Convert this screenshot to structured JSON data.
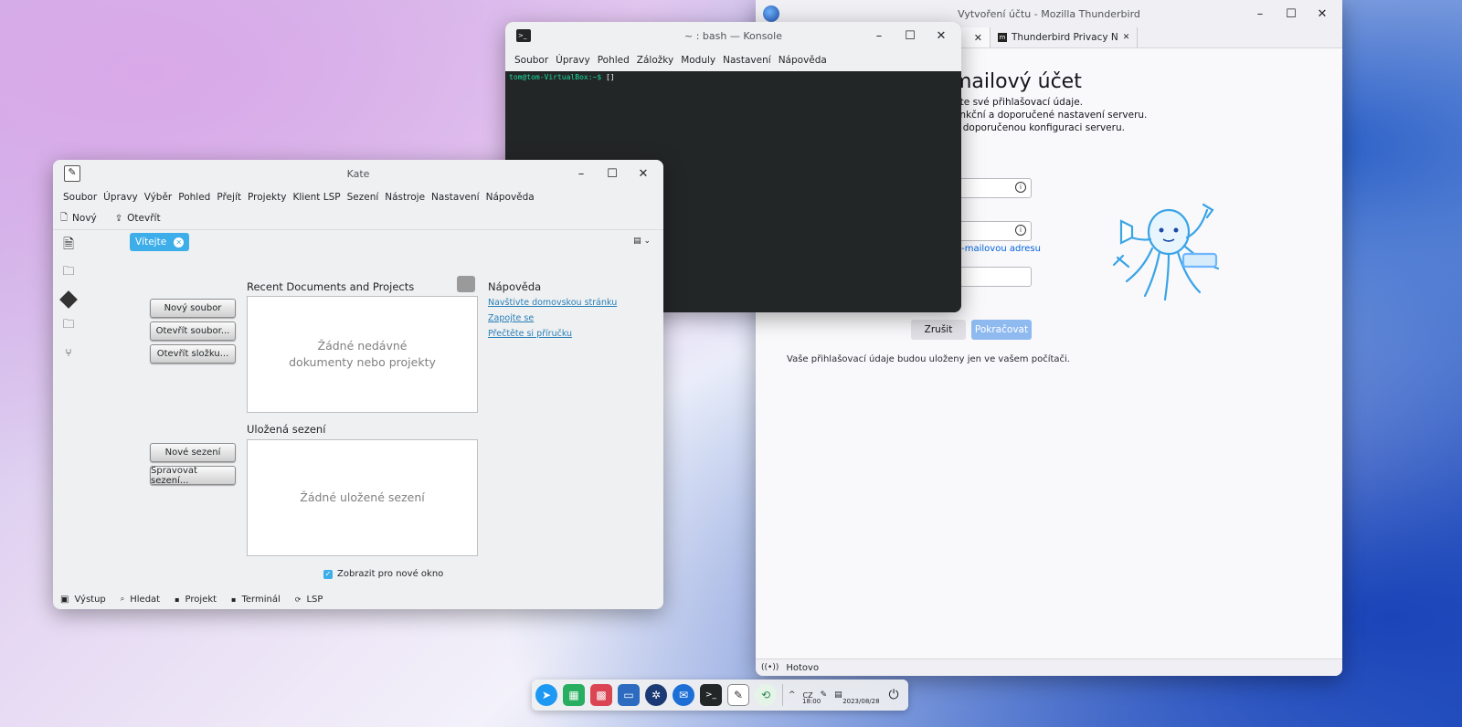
{
  "thunderbird": {
    "window_title": "Vytvoření účtu - Mozilla Thunderbird",
    "tabs": [
      {
        "label": "",
        "close": "✕"
      },
      {
        "label": "Thunderbird Privacy N",
        "close": "✕"
      }
    ],
    "heading": "mailový účet",
    "lines": [
      "ňte své přihlašovací údaje.",
      "ankční a doporučené nastavení serveru.",
      "a doporučenou konfiguraci serveru."
    ],
    "email_link": "e-mailovou adresu",
    "cancel_label": "Zrušit",
    "continue_label": "Pokračovat",
    "note": "Vaše přihlašovací údaje budou uloženy jen ve vašem počítači.",
    "status": "Hotovo"
  },
  "konsole": {
    "window_title": "~ : bash — Konsole",
    "menu": [
      "Soubor",
      "Úpravy",
      "Pohled",
      "Záložky",
      "Moduly",
      "Nastavení",
      "Nápověda"
    ],
    "prompt": "tom@tom-VirtualBox:~$",
    "cursor": "[]"
  },
  "kate": {
    "window_title": "Kate",
    "menu": [
      "Soubor",
      "Úpravy",
      "Výběr",
      "Pohled",
      "Přejít",
      "Projekty",
      "Klient LSP",
      "Sezení",
      "Nástroje",
      "Nastavení",
      "Nápověda"
    ],
    "toolbar": {
      "new": "Nový",
      "open": "Otevřít"
    },
    "tab_label": "Vítejte",
    "buttons": {
      "new_file": "Nový soubor",
      "open_file": "Otevřít soubor...",
      "open_folder": "Otevřít složku...",
      "new_session": "Nové sezení",
      "manage_sessions": "Spravovat sezení..."
    },
    "recent_title": "Recent Documents and Projects",
    "recent_empty": "Žádné nedávné dokumenty nebo projekty",
    "sessions_title": "Uložená sezení",
    "sessions_empty": "Žádné uložené sezení",
    "help_title": "Nápověda",
    "help_links": [
      "Navštivte domovskou stránku",
      "Zapojte se",
      "Přečtěte si příručku"
    ],
    "show_checkbox": "Zobrazit pro nové okno",
    "bottom": [
      "Výstup",
      "Hledat",
      "Projekt",
      "Terminál",
      "LSP"
    ]
  },
  "taskbar": {
    "clock": "18:00",
    "date": "2023/08/28",
    "keyboard": "CZ"
  }
}
